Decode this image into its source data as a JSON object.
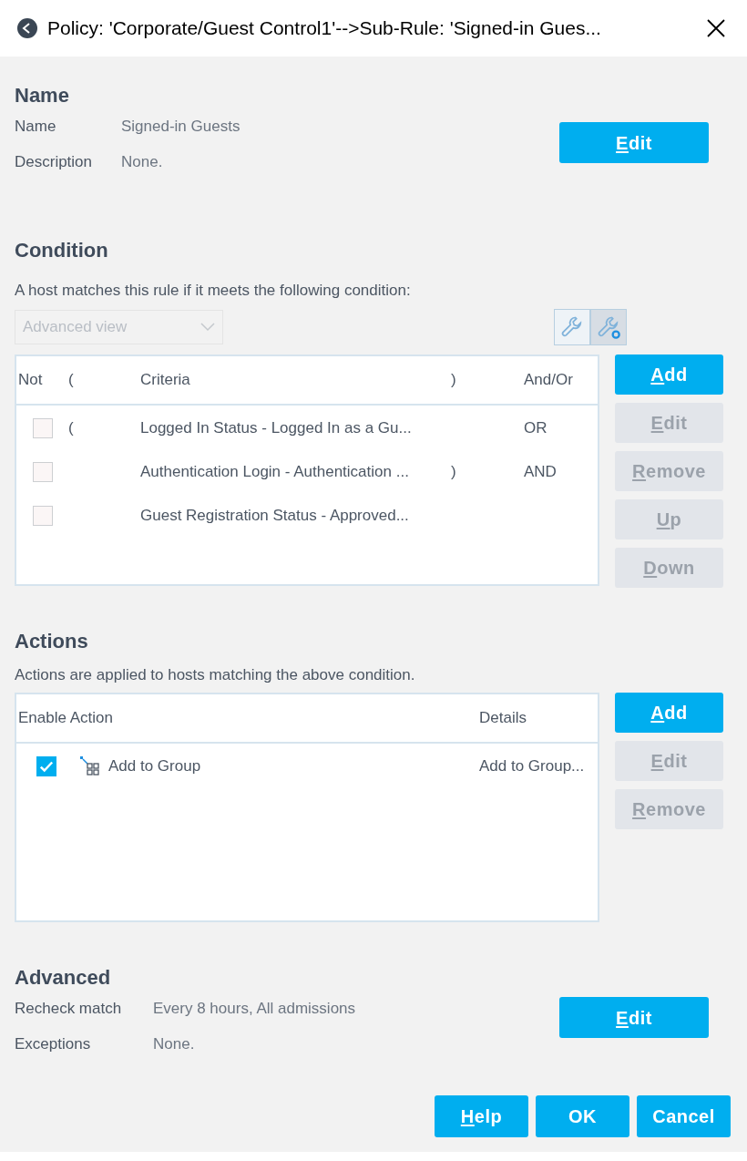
{
  "window": {
    "title": "Policy: 'Corporate/Guest Control1'-->Sub-Rule: 'Signed-in Gues..."
  },
  "name_section": {
    "heading": "Name",
    "fields": [
      {
        "label": "Name",
        "value": "Signed-in Guests"
      },
      {
        "label": "Description",
        "value": "None."
      }
    ],
    "button": {
      "label": "Edit",
      "mnemonic": true,
      "disabled": false
    }
  },
  "condition": {
    "heading": "Condition",
    "description": "A host matches this rule if it meets the following condition:",
    "view_select": {
      "value": "Advanced view",
      "disabled": true
    },
    "view_toggles": [
      {
        "kind": "basic",
        "selected": false
      },
      {
        "kind": "advanced",
        "selected": true
      }
    ],
    "table": {
      "columns": [
        "Not",
        "(",
        "Criteria",
        ")",
        "And/Or"
      ],
      "rows": [
        {
          "not": false,
          "open": "(",
          "criteria": "Logged In Status - Logged In as a Gu...",
          "close": "",
          "and_or": "OR"
        },
        {
          "not": false,
          "open": "",
          "criteria": "Authentication Login - Authentication ...",
          "close": ")",
          "and_or": "AND"
        },
        {
          "not": false,
          "open": "",
          "criteria": "Guest Registration Status - Approved...",
          "close": "",
          "and_or": ""
        }
      ]
    },
    "buttons": [
      {
        "label": "Add",
        "mnemonic": true,
        "disabled": false
      },
      {
        "label": "Edit",
        "mnemonic": true,
        "disabled": true
      },
      {
        "label": "Remove",
        "mnemonic": true,
        "disabled": true
      },
      {
        "label": "Up",
        "mnemonic": true,
        "disabled": true
      },
      {
        "label": "Down",
        "mnemonic": true,
        "disabled": true
      }
    ]
  },
  "actions": {
    "heading": "Actions",
    "description": "Actions are applied to hosts matching the above condition.",
    "table": {
      "columns": [
        "Enable Action",
        "Details"
      ],
      "rows": [
        {
          "enabled": true,
          "action": "Add to Group",
          "details": "Add to Group..."
        }
      ]
    },
    "buttons": [
      {
        "label": "Add",
        "mnemonic": true,
        "disabled": false
      },
      {
        "label": "Edit",
        "mnemonic": true,
        "disabled": true
      },
      {
        "label": "Remove",
        "mnemonic": true,
        "disabled": true
      }
    ]
  },
  "advanced": {
    "heading": "Advanced",
    "fields": [
      {
        "label": "Recheck match",
        "value": "Every 8 hours, All admissions"
      },
      {
        "label": "Exceptions",
        "value": "None."
      }
    ],
    "button": {
      "label": "Edit",
      "mnemonic": true,
      "disabled": false
    }
  },
  "footer_buttons": [
    {
      "label": "Help",
      "mnemonic": true,
      "disabled": false
    },
    {
      "label": "OK",
      "mnemonic": false,
      "disabled": false
    },
    {
      "label": "Cancel",
      "mnemonic": false,
      "disabled": false
    }
  ]
}
